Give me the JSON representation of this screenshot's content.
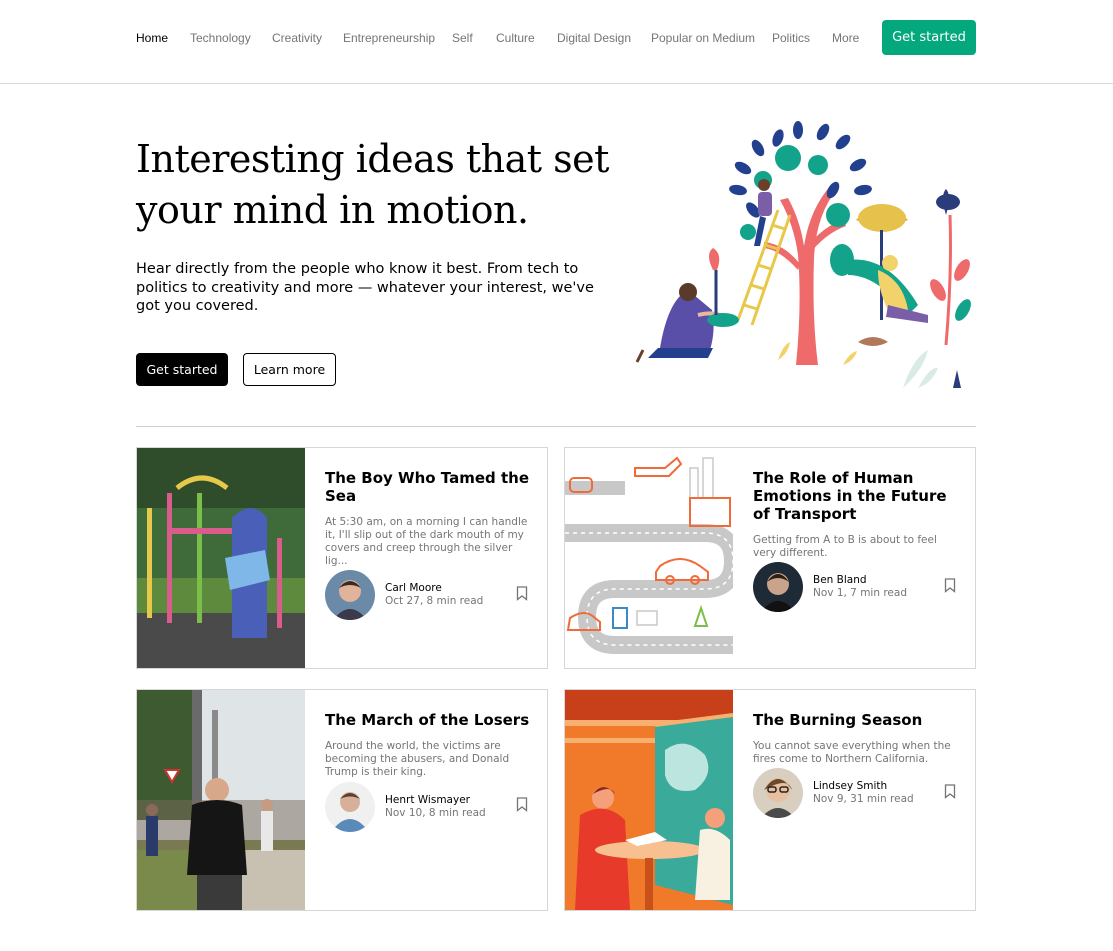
{
  "nav": {
    "items": [
      {
        "label": "Home"
      },
      {
        "label": "Technology"
      },
      {
        "label": "Creativity"
      },
      {
        "label": "Entrepreneurship"
      },
      {
        "label": "Self"
      },
      {
        "label": "Culture"
      },
      {
        "label": "Digital Design"
      },
      {
        "label": "Popular on Medium"
      },
      {
        "label": "Politics"
      },
      {
        "label": "More"
      }
    ],
    "cta": "Get started"
  },
  "hero": {
    "title": "Interesting ideas that set your mind in motion.",
    "subtitle": "Hear directly from the people who know it best. From tech to politics to creativity and more — whatever your interest, we've got you covered.",
    "primary_button": "Get started",
    "secondary_button": "Learn more"
  },
  "articles": [
    {
      "title": "The Boy Who Tamed the Sea",
      "excerpt": "At 5:30 am, on a morning I can handle it, I'll slip out of the dark mouth of my covers and creep through the silver lig...",
      "author": "Carl Moore",
      "meta": "Oct 27, 8 min read"
    },
    {
      "title": "The Role of Human Emotions in the Future of Transport",
      "excerpt": "Getting from A to B is about to feel very different.",
      "author": "Ben Bland",
      "meta": "Nov 1, 7 min read"
    },
    {
      "title": "The March of the Losers",
      "excerpt": "Around the world, the victims are becoming the abusers, and Donald Trump is their king.",
      "author": "Henrt Wismayer",
      "meta": "Nov 10, 8 min read"
    },
    {
      "title": "The Burning Season",
      "excerpt": "You cannot save everything when the fires come to Northern California.",
      "author": "Lindsey Smith",
      "meta": "Nov 9, 31 min read"
    }
  ],
  "colors": {
    "brand_green": "#03a87c",
    "text_muted": "#757575"
  },
  "icons": [
    "bookmark-icon"
  ]
}
